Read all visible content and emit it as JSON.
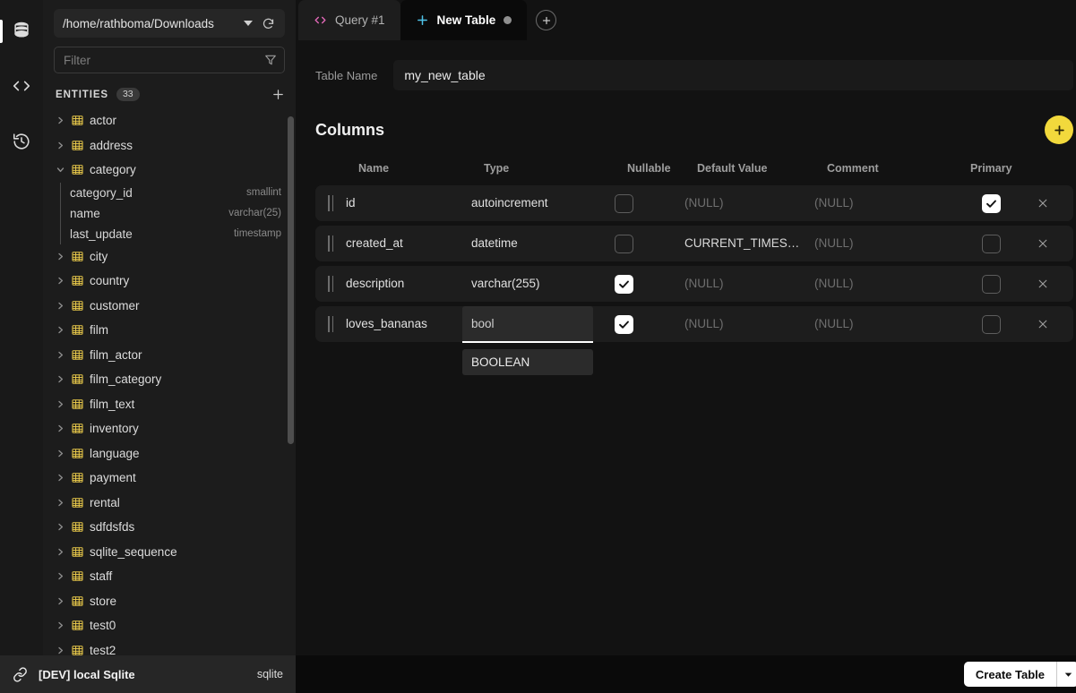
{
  "rail": {
    "items": [
      {
        "name": "database-icon",
        "label": "Database",
        "active": true
      },
      {
        "name": "code-icon",
        "label": "Query",
        "active": false
      },
      {
        "name": "history-icon",
        "label": "History",
        "active": false
      }
    ]
  },
  "sidebar": {
    "connection_path": "/home/rathboma/Downloads",
    "filter_placeholder": "Filter",
    "filter_value": "",
    "entities_label": "ENTITIES",
    "entities_count": "33",
    "tree": [
      {
        "label": "actor",
        "expanded": false
      },
      {
        "label": "address",
        "expanded": false
      },
      {
        "label": "category",
        "expanded": true,
        "children": [
          {
            "name": "category_id",
            "type": "smallint"
          },
          {
            "name": "name",
            "type": "varchar(25)"
          },
          {
            "name": "last_update",
            "type": "timestamp"
          }
        ]
      },
      {
        "label": "city",
        "expanded": false
      },
      {
        "label": "country",
        "expanded": false
      },
      {
        "label": "customer",
        "expanded": false
      },
      {
        "label": "film",
        "expanded": false
      },
      {
        "label": "film_actor",
        "expanded": false
      },
      {
        "label": "film_category",
        "expanded": false
      },
      {
        "label": "film_text",
        "expanded": false
      },
      {
        "label": "inventory",
        "expanded": false
      },
      {
        "label": "language",
        "expanded": false
      },
      {
        "label": "payment",
        "expanded": false
      },
      {
        "label": "rental",
        "expanded": false
      },
      {
        "label": "sdfdsfds",
        "expanded": false
      },
      {
        "label": "sqlite_sequence",
        "expanded": false
      },
      {
        "label": "staff",
        "expanded": false
      },
      {
        "label": "store",
        "expanded": false
      },
      {
        "label": "test0",
        "expanded": false
      },
      {
        "label": "test2",
        "expanded": false
      }
    ]
  },
  "statusbar": {
    "connection_name": "[DEV] local Sqlite",
    "engine": "sqlite"
  },
  "tabs": [
    {
      "label": "Query #1",
      "icon": "code-icon",
      "active": false,
      "modified": false
    },
    {
      "label": "New Table",
      "icon": "plus-icon",
      "active": true,
      "modified": true
    }
  ],
  "tab_add_label": "+",
  "editor": {
    "table_name_label": "Table Name",
    "table_name_value": "my_new_table",
    "columns_title": "Columns",
    "add_column_label": "+",
    "headers": {
      "name": "Name",
      "type": "Type",
      "nullable": "Nullable",
      "default": "Default Value",
      "comment": "Comment",
      "primary": "Primary"
    },
    "rows": [
      {
        "name": "id",
        "type": "autoincrement",
        "nullable": false,
        "default": "(NULL)",
        "default_is_null": true,
        "comment": "(NULL)",
        "comment_is_null": true,
        "primary": true,
        "editing": false
      },
      {
        "name": "created_at",
        "type": "datetime",
        "nullable": false,
        "default": "CURRENT_TIMES…",
        "default_is_null": false,
        "comment": "(NULL)",
        "comment_is_null": true,
        "primary": false,
        "editing": false
      },
      {
        "name": "description",
        "type": "varchar(255)",
        "nullable": true,
        "default": "(NULL)",
        "default_is_null": true,
        "comment": "(NULL)",
        "comment_is_null": true,
        "primary": false,
        "editing": false
      },
      {
        "name": "loves_bananas",
        "type": "bool",
        "nullable": true,
        "default": "(NULL)",
        "default_is_null": true,
        "comment": "(NULL)",
        "comment_is_null": true,
        "primary": false,
        "editing": true
      }
    ],
    "type_autocomplete": {
      "input_value": "bool",
      "options": [
        "BOOLEAN"
      ]
    }
  },
  "actionbar": {
    "create_label": "Create Table"
  },
  "colors": {
    "accent_yellow": "#f2d93c",
    "tab_code_icon": "#e268b8",
    "tab_plus_icon": "#4fc3e8",
    "table_icon": "#e8c84a"
  }
}
